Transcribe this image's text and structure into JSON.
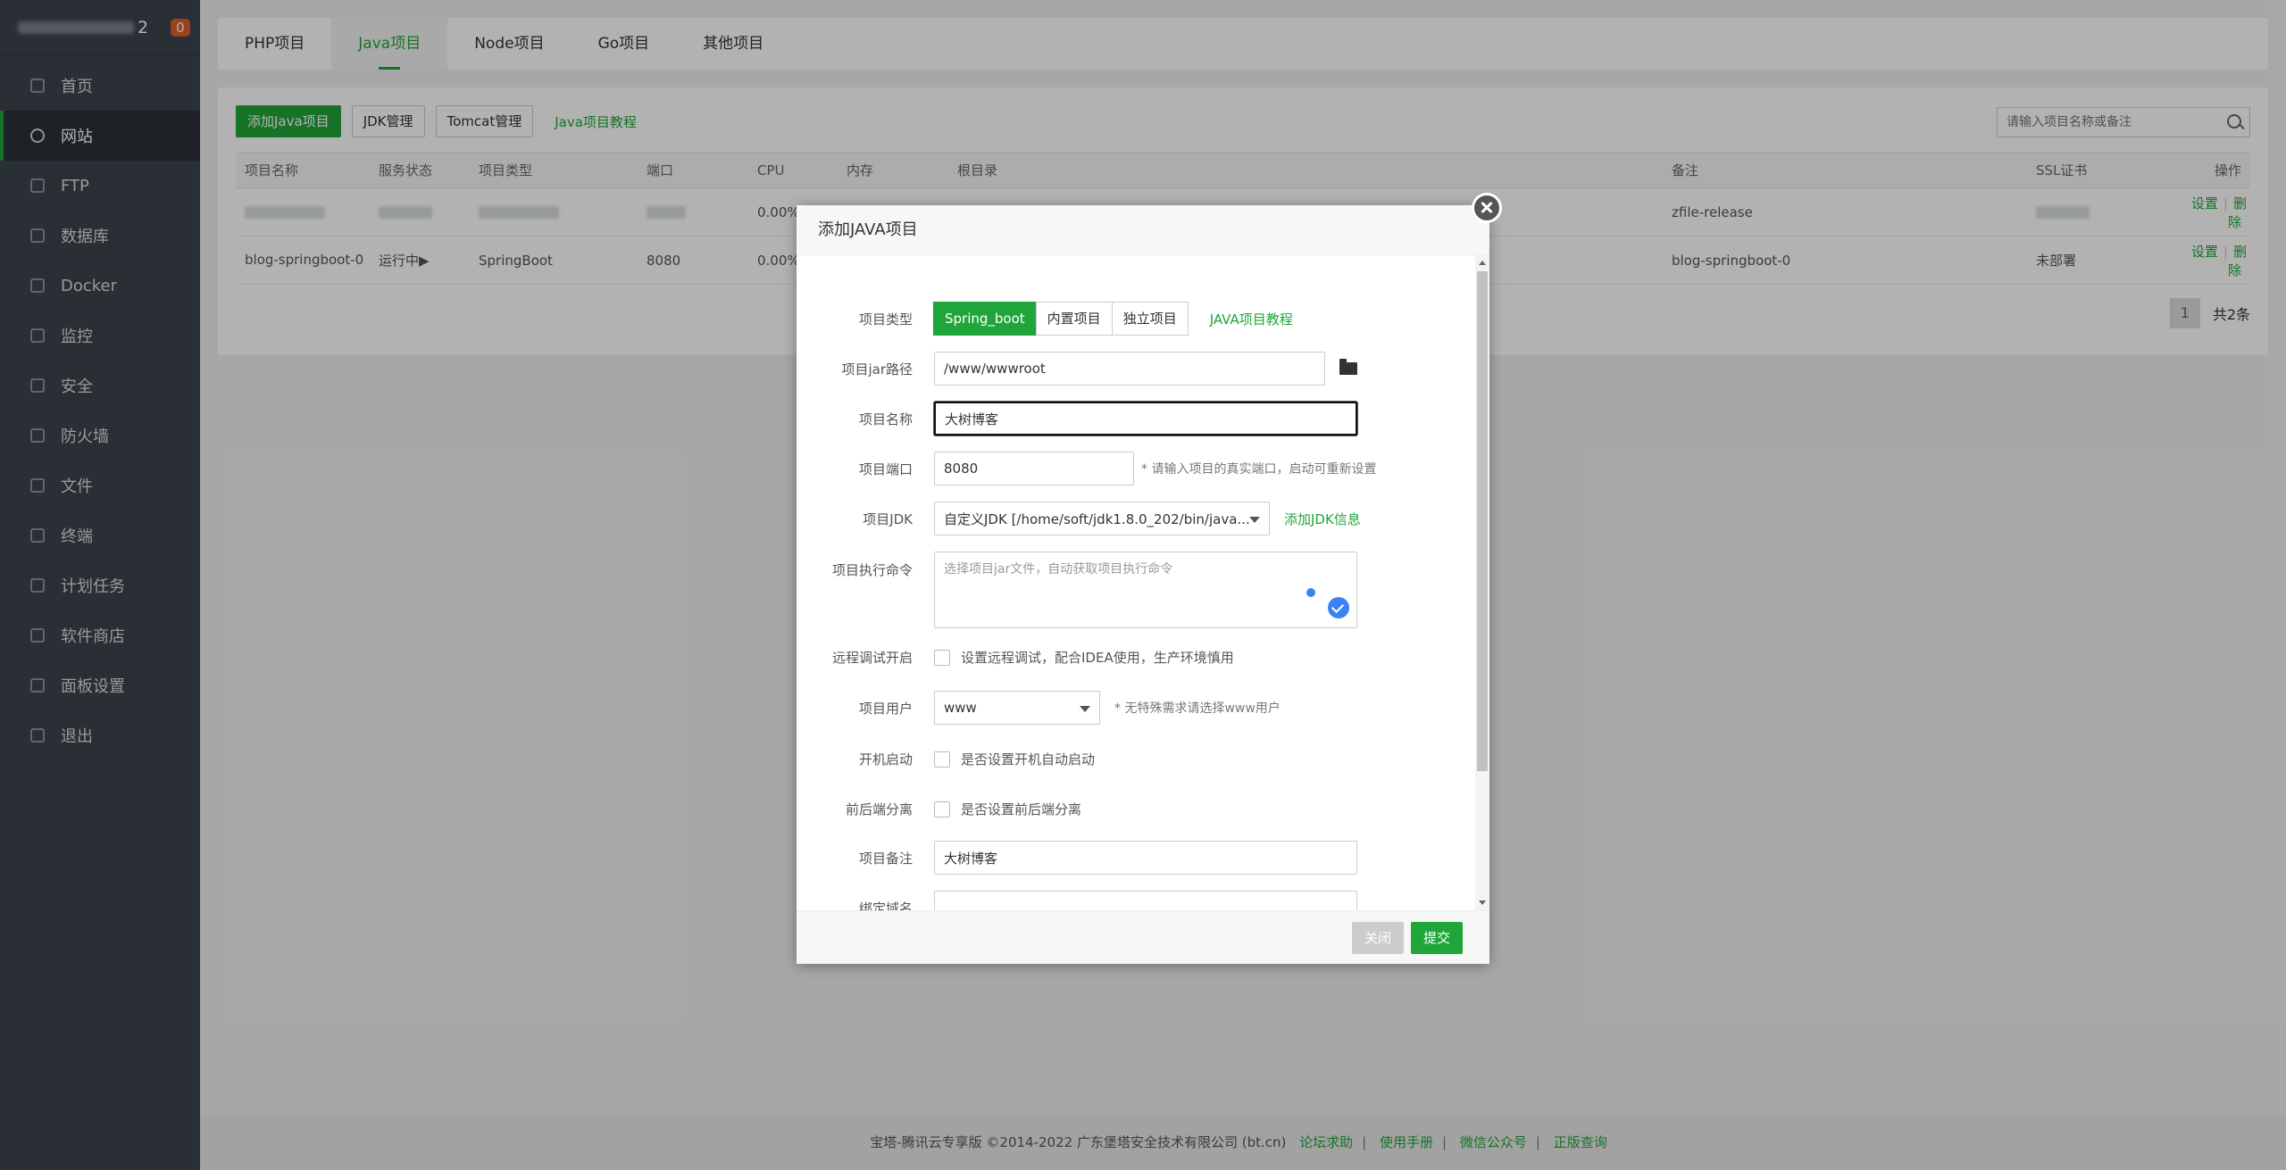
{
  "sidebar": {
    "server_suffix": "2",
    "badge": "0",
    "items": [
      {
        "label": "首页",
        "icon": "home-icon"
      },
      {
        "label": "网站",
        "icon": "globe-icon"
      },
      {
        "label": "FTP",
        "icon": "ftp-icon"
      },
      {
        "label": "数据库",
        "icon": "database-icon"
      },
      {
        "label": "Docker",
        "icon": "docker-icon"
      },
      {
        "label": "监控",
        "icon": "monitor-icon"
      },
      {
        "label": "安全",
        "icon": "shield-icon"
      },
      {
        "label": "防火墙",
        "icon": "firewall-icon"
      },
      {
        "label": "文件",
        "icon": "folder-icon"
      },
      {
        "label": "终端",
        "icon": "terminal-icon"
      },
      {
        "label": "计划任务",
        "icon": "calendar-icon"
      },
      {
        "label": "软件商店",
        "icon": "apps-icon"
      },
      {
        "label": "面板设置",
        "icon": "gear-icon"
      },
      {
        "label": "退出",
        "icon": "logout-icon"
      }
    ]
  },
  "tabs": [
    "PHP项目",
    "Java项目",
    "Node项目",
    "Go项目",
    "其他项目"
  ],
  "toolbar": {
    "add": "添加Java项目",
    "jdk": "JDK管理",
    "tomcat": "Tomcat管理",
    "tutorial": "Java项目教程",
    "search_placeholder": "请输入项目名称或备注"
  },
  "table": {
    "headers": [
      "项目名称",
      "服务状态",
      "项目类型",
      "端口",
      "CPU",
      "内存",
      "根目录",
      "备注",
      "SSL证书",
      "操作"
    ],
    "row1": {
      "cpu": "0.00%",
      "remark": "zfile-release"
    },
    "row2": {
      "name": "blog-springboot-0",
      "status": "运行中▶",
      "type": "SpringBoot",
      "port": "8080",
      "cpu": "0.00%",
      "remark": "blog-springboot-0",
      "ssl": "未部署"
    },
    "ops_set": "设置",
    "ops_del": "删除",
    "ops_sep": "|"
  },
  "pager": {
    "page": "1",
    "total": "共2条"
  },
  "footer": {
    "text": "宝塔-腾讯云专享版 ©2014-2022 广东堡塔安全技术有限公司 (bt.cn)",
    "links": [
      "论坛求助",
      "使用手册",
      "微信公众号",
      "正版查询"
    ],
    "sep": "|"
  },
  "modal": {
    "title": "添加JAVA项目",
    "type_label": "项目类型",
    "types": [
      "Spring_boot",
      "内置项目",
      "独立项目"
    ],
    "type_tutorial": "JAVA项目教程",
    "jar_label": "项目jar路径",
    "jar_value": "/www/wwwroot",
    "name_label": "项目名称",
    "name_value": "大树博客",
    "port_label": "项目端口",
    "port_value": "8080",
    "port_hint": "* 请输入项目的真实端口，启动可重新设置",
    "jdk_label": "项目JDK",
    "jdk_value": "自定义JDK [/home/soft/jdk1.8.0_202/bin/java...",
    "jdk_add": "添加JDK信息",
    "cmd_label": "项目执行命令",
    "cmd_placeholder": "选择项目jar文件，自动获取项目执行命令",
    "debug_label": "远程调试开启",
    "debug_text": "设置远程调试，配合IDEA使用，生产环境慎用",
    "user_label": "项目用户",
    "user_value": "www",
    "user_hint": "* 无特殊需求请选择www用户",
    "boot_label": "开机启动",
    "boot_text": "是否设置开机自动启动",
    "split_label": "前后端分离",
    "split_text": "是否设置前后端分离",
    "remark_label": "项目备注",
    "remark_value": "大树博客",
    "domain_label": "绑定域名",
    "cancel": "关闭",
    "submit": "提交"
  },
  "colors": {
    "accent": "#20a53a",
    "sidebar": "#3c444d",
    "badge": "#e05d2b"
  }
}
